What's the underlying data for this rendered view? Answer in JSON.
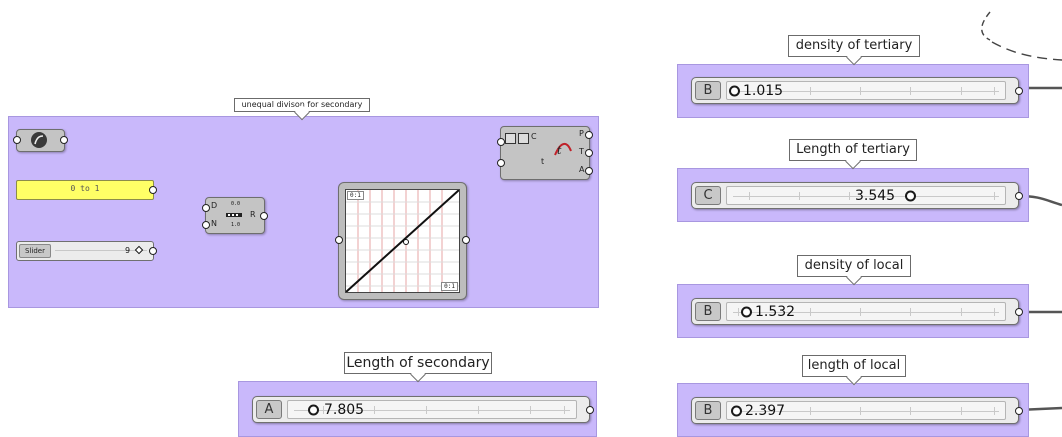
{
  "left_group": {
    "label": "unequal divison for secondary",
    "panel_text": "0 to 1",
    "slider_label": "Slider",
    "slider_value": "9",
    "slider_fraction": 0.85,
    "component_inputs": [
      "D",
      "N"
    ],
    "component_output": "R",
    "component_mini": [
      "0.0",
      "1.0"
    ],
    "graph_tag_top": "0:1",
    "graph_tag_bottom": "0:1",
    "eval_inputs": [
      "C",
      "t"
    ],
    "eval_outputs": [
      "P",
      "T",
      "A"
    ]
  },
  "sliders": [
    {
      "id": "secondary",
      "callout": "Length of secondary",
      "letter": "A",
      "value": "7.805",
      "fraction": 0.08
    },
    {
      "id": "density-tertiary",
      "callout": "density of tertiary",
      "letter": "B",
      "value": "1.015",
      "fraction": 0.0
    },
    {
      "id": "length-tertiary",
      "callout": "Length of tertiary",
      "letter": "C",
      "value": "3.545",
      "fraction": 0.6
    },
    {
      "id": "density-local",
      "callout": "density of local",
      "letter": "B",
      "value": "1.532",
      "fraction": 0.05
    },
    {
      "id": "length-local",
      "callout": "length of local",
      "letter": "B",
      "value": "2.397",
      "fraction": 0.01
    }
  ],
  "colors": {
    "group_fill": "#c9b8fb",
    "panel_yellow": "#ffff66",
    "wire": "#555555"
  }
}
